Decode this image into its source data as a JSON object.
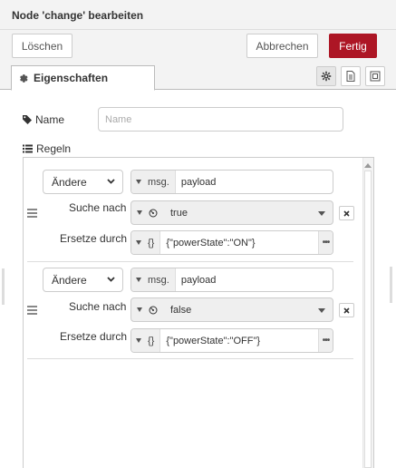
{
  "dialog": {
    "title": "Node 'change' bearbeiten"
  },
  "toolbar": {
    "delete_label": "Löschen",
    "cancel_label": "Abbrechen",
    "done_label": "Fertig"
  },
  "tabs": {
    "properties_label": "Eigenschaften"
  },
  "form": {
    "name_label": "Name",
    "name_placeholder": "Name",
    "name_value": "",
    "rules_label": "Regeln"
  },
  "rules": [
    {
      "action": "Ändere",
      "target_type": "msg.",
      "target_value": "payload",
      "search_label": "Suche nach",
      "search_value": "true",
      "replace_label": "Ersetze durch",
      "replace_type": "{}",
      "replace_value": "{\"powerState\":\"ON\"}"
    },
    {
      "action": "Ändere",
      "target_type": "msg.",
      "target_value": "payload",
      "search_label": "Suche nach",
      "search_value": "false",
      "replace_label": "Ersetze durch",
      "replace_type": "{}",
      "replace_value": "{\"powerState\":\"OFF\"}"
    }
  ],
  "colors": {
    "primary": "#ad1625",
    "header_bg": "#f3f3f3"
  }
}
